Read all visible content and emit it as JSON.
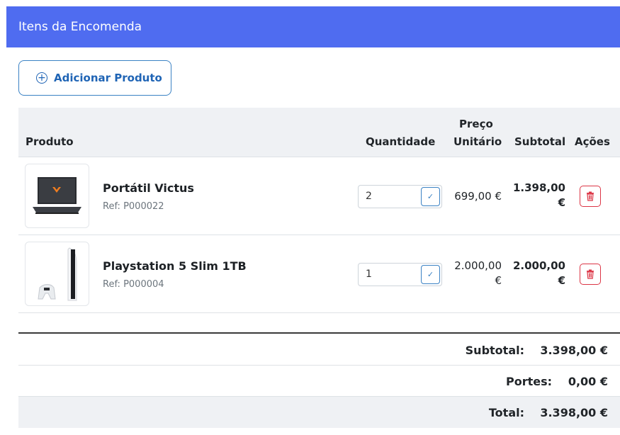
{
  "header": {
    "title": "Itens da Encomenda"
  },
  "add_button": {
    "label": "Adicionar Produto",
    "icon": "plus-circle-icon"
  },
  "table": {
    "columns": {
      "product": "Produto",
      "quantity": "Quantidade",
      "unit_price_line1": "Preço",
      "unit_price_line2": "Unitário",
      "subtotal": "Subtotal",
      "actions": "Ações"
    },
    "rows": [
      {
        "name": "Portátil Victus",
        "ref": "Ref: P000022",
        "quantity": "2",
        "unit_price_line1": "699,00 €",
        "unit_price_line2": "",
        "subtotal_line1": "1.398,00",
        "subtotal_line2": "€",
        "image": "laptop-image"
      },
      {
        "name": "Playstation 5 Slim 1TB",
        "ref": "Ref: P000004",
        "quantity": "1",
        "unit_price_line1": "2.000,00",
        "unit_price_line2": "€",
        "subtotal_line1": "2.000,00",
        "subtotal_line2": "€",
        "image": "console-image"
      }
    ]
  },
  "totals": {
    "subtotal_label": "Subtotal:",
    "subtotal_value": "3.398,00 €",
    "shipping_label": "Portes:",
    "shipping_value": "0,00 €",
    "total_label": "Total:",
    "total_value": "3.398,00 €"
  },
  "colors": {
    "header_bg": "#4f6cf0",
    "accent": "#1f64b5",
    "danger": "#dc3545"
  }
}
